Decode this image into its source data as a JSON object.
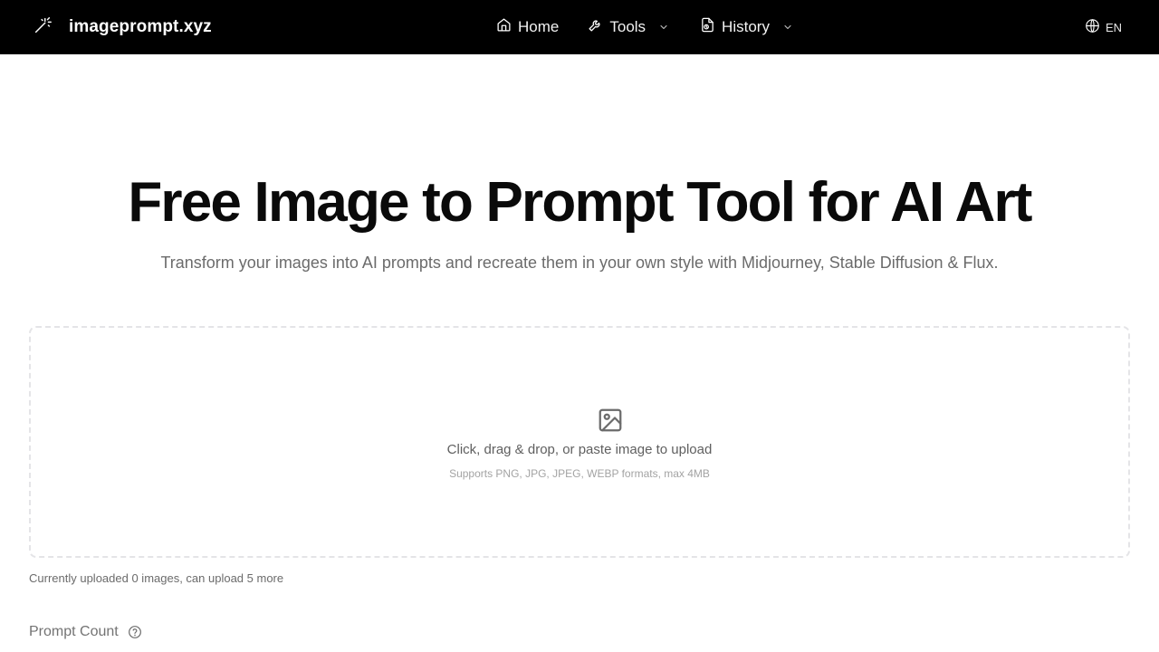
{
  "header": {
    "brand": "imageprompt.xyz",
    "brand_icon": "magic-wand-icon",
    "nav": {
      "home": "Home",
      "tools": "Tools",
      "history": "History"
    },
    "language": "EN"
  },
  "hero": {
    "title": "Free Image to Prompt Tool for AI Art",
    "subtitle": "Transform your images into AI prompts and recreate them in your own style with Midjourney, Stable Diffusion & Flux."
  },
  "upload": {
    "icon": "image-icon",
    "instruction": "Click, drag & drop, or paste image to upload",
    "formats_hint": "Supports PNG, JPG, JPEG, WEBP formats, max 4MB",
    "status": "Currently uploaded 0 images, can upload 5 more"
  },
  "settings": {
    "prompt_count_label": "Prompt Count"
  },
  "colors": {
    "header_bg": "#000000",
    "accent_text": "#0a0a0a",
    "muted_text": "#6b6b6b",
    "dropzone_border": "#e4e4e7"
  }
}
